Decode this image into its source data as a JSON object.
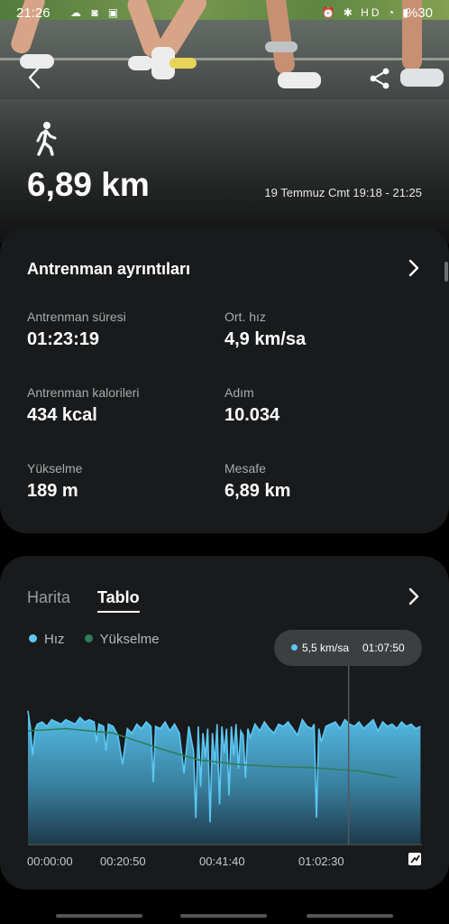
{
  "status_bar": {
    "time": "21:26",
    "battery": "%30",
    "left_icons": [
      "cloud-icon",
      "instagram-icon",
      "image-icon"
    ],
    "right_icons": [
      "alarm-icon",
      "bluetooth-icon",
      "hd-icon",
      "wifi-icon",
      "signal-icon",
      "battery-icon"
    ]
  },
  "header": {
    "distance": "6,89 km",
    "date_range": "19 Temmuz Cmt 19:18 - 21:25",
    "activity_icon": "walking-icon"
  },
  "details": {
    "title": "Antrenman ayrıntıları",
    "stats": [
      {
        "label": "Antrenman süresi",
        "value": "01:23:19"
      },
      {
        "label": "Ort. hız",
        "value": "4,9 km/sa"
      },
      {
        "label": "Antrenman kalorileri",
        "value": "434 kcal"
      },
      {
        "label": "Adım",
        "value": "10.034"
      },
      {
        "label": "Yükselme",
        "value": "189 m"
      },
      {
        "label": "Mesafe",
        "value": "6,89 km"
      }
    ]
  },
  "chart_section": {
    "tabs": [
      {
        "label": "Harita",
        "active": false
      },
      {
        "label": "Tablo",
        "active": true
      }
    ],
    "legend": [
      {
        "label": "Hız",
        "color": "#5bc8f5"
      },
      {
        "label": "Yükselme",
        "color": "#2e7d5b"
      }
    ],
    "tooltip": {
      "speed": "5,5 km/sa",
      "time": "01:07:50"
    },
    "x_ticks": [
      "00:00:00",
      "00:20:50",
      "00:41:40",
      "01:02:30"
    ]
  },
  "chart_data": {
    "type": "area",
    "x_unit": "minutes",
    "x_range": [
      0,
      83.3
    ],
    "speed_series": {
      "name": "Hız",
      "color": "#5bc8f5",
      "x": [
        0,
        0.5,
        1,
        1.6,
        2,
        3,
        4,
        5,
        6,
        7,
        8,
        9,
        10,
        11,
        12,
        13,
        14,
        14.5,
        15,
        16,
        16.5,
        17,
        18,
        19,
        20,
        21,
        22,
        23,
        24,
        25,
        26,
        26.5,
        27,
        28,
        29,
        30,
        31,
        32,
        33,
        34,
        35,
        35.5,
        36,
        36.5,
        37,
        37.5,
        38,
        38.5,
        39,
        39.5,
        40,
        40.5,
        41,
        41.5,
        42,
        42.5,
        43,
        43.5,
        44,
        44.5,
        45,
        45.5,
        46,
        46.5,
        47,
        48,
        49,
        50,
        51,
        52,
        53,
        54,
        55,
        56,
        57,
        58,
        59,
        60,
        60.5,
        61,
        61.5,
        62,
        63,
        64,
        65,
        66,
        67,
        68,
        69,
        70,
        71,
        72,
        73,
        74,
        75,
        76,
        77,
        78,
        79,
        80,
        81,
        82,
        83
      ],
      "y": [
        6.0,
        5.3,
        4.0,
        5.2,
        5.4,
        5.5,
        5.3,
        5.6,
        5.5,
        5.4,
        5.6,
        5.5,
        5.4,
        5.7,
        5.5,
        5.6,
        5.5,
        4.6,
        5.4,
        5.3,
        4.2,
        5.4,
        5.3,
        4.9,
        3.6,
        5.2,
        5.0,
        5.4,
        5.2,
        5.5,
        5.3,
        2.8,
        5.3,
        5.2,
        5.5,
        5.1,
        5.4,
        5.0,
        3.2,
        5.3,
        4.2,
        1.2,
        5.3,
        2.6,
        5.0,
        3.9,
        5.2,
        1.0,
        5.0,
        3.6,
        5.4,
        1.8,
        5.3,
        4.1,
        5.2,
        2.2,
        5.3,
        4.0,
        5.4,
        3.4,
        5.1,
        4.9,
        3.0,
        5.2,
        4.8,
        5.4,
        5.1,
        5.5,
        5.2,
        5.0,
        5.4,
        5.3,
        5.5,
        5.2,
        4.9,
        5.6,
        5.3,
        5.2,
        5.4,
        1.2,
        5.2,
        4.6,
        5.3,
        5.4,
        5.5,
        5.2,
        5.6,
        5.4,
        5.3,
        5.5,
        5.2,
        5.4,
        5.6,
        5.1,
        5.5,
        5.3,
        5.4,
        5.2,
        5.5,
        5.3,
        5.4,
        5.2,
        5.3
      ]
    },
    "elevation_series": {
      "name": "Yükselme",
      "color": "#2e7d5b",
      "x": [
        0,
        8,
        18,
        28,
        36,
        44,
        52,
        60,
        70,
        78
      ],
      "y": [
        5.1,
        5.2,
        5.0,
        4.3,
        3.8,
        3.6,
        3.5,
        3.45,
        3.3,
        3.0
      ]
    },
    "y_range": [
      0,
      7
    ],
    "cursor_x": 67.8,
    "xlabel": "",
    "ylabel": ""
  }
}
